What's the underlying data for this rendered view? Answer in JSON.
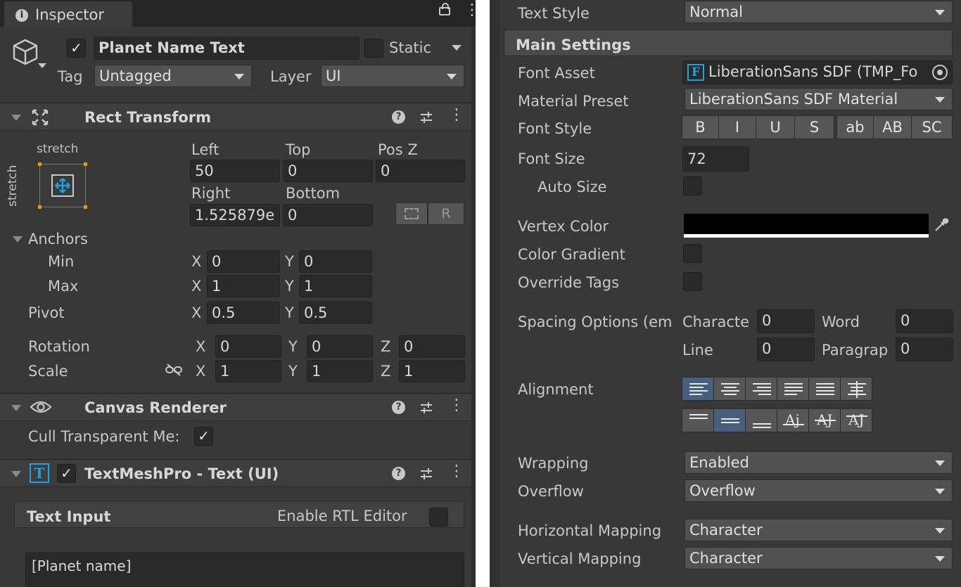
{
  "inspector": {
    "tab_label": "Inspector",
    "object_name": "Planet Name Text",
    "static_label": "Static",
    "tag_label": "Tag",
    "tag_value": "Untagged",
    "layer_label": "Layer",
    "layer_value": "UI"
  },
  "rect_transform": {
    "title": "Rect Transform",
    "preset_h": "stretch",
    "preset_v": "stretch",
    "left_label": "Left",
    "left_value": "50",
    "top_label": "Top",
    "top_value": "0",
    "posz_label": "Pos Z",
    "posz_value": "0",
    "right_label": "Right",
    "right_value": "1.525879e",
    "bottom_label": "Bottom",
    "bottom_value": "0",
    "r_button": "R",
    "anchors_label": "Anchors",
    "min_label": "Min",
    "min_x": "0",
    "min_y": "0",
    "max_label": "Max",
    "max_x": "1",
    "max_y": "1",
    "pivot_label": "Pivot",
    "pivot_x": "0.5",
    "pivot_y": "0.5",
    "rotation_label": "Rotation",
    "rot_x": "0",
    "rot_y": "0",
    "rot_z": "0",
    "scale_label": "Scale",
    "scale_x": "1",
    "scale_y": "1",
    "scale_z": "1",
    "x": "X",
    "y": "Y",
    "z": "Z"
  },
  "canvas_renderer": {
    "title": "Canvas Renderer",
    "cull_label": "Cull Transparent Me:"
  },
  "tmp": {
    "title": "TextMeshPro - Text (UI)",
    "text_input_label": "Text Input",
    "rtl_label": "Enable RTL Editor",
    "text_value": "[Planet name]"
  },
  "settings": {
    "text_style_label": "Text Style",
    "text_style_value": "Normal",
    "main_settings": "Main Settings",
    "font_asset_label": "Font Asset",
    "font_asset_value": "LiberationSans SDF (TMP_Fo",
    "material_label": "Material Preset",
    "material_value": "LiberationSans SDF Material",
    "font_style_label": "Font Style",
    "font_style_buttons": [
      "B",
      "I",
      "U",
      "S",
      "ab",
      "AB",
      "SC"
    ],
    "font_size_label": "Font Size",
    "font_size_value": "72",
    "auto_size_label": "Auto Size",
    "vertex_color_label": "Vertex Color",
    "vertex_color": "#000000",
    "color_gradient_label": "Color Gradient",
    "override_tags_label": "Override Tags",
    "spacing_label": "Spacing Options (em",
    "character_label": "Characte",
    "character_value": "0",
    "word_label": "Word",
    "word_value": "0",
    "line_label": "Line",
    "line_value": "0",
    "paragraph_label": "Paragrap",
    "paragraph_value": "0",
    "alignment_label": "Alignment",
    "wrapping_label": "Wrapping",
    "wrapping_value": "Enabled",
    "overflow_label": "Overflow",
    "overflow_value": "Overflow",
    "hmap_label": "Horizontal Mapping",
    "hmap_value": "Character",
    "vmap_label": "Vertical Mapping",
    "vmap_value": "Character"
  },
  "colors": {
    "panel_bg": "#383838",
    "field_bg": "#2a2a2a",
    "selected_accent": "#46607c",
    "icon_blue": "#1fa3e0"
  }
}
